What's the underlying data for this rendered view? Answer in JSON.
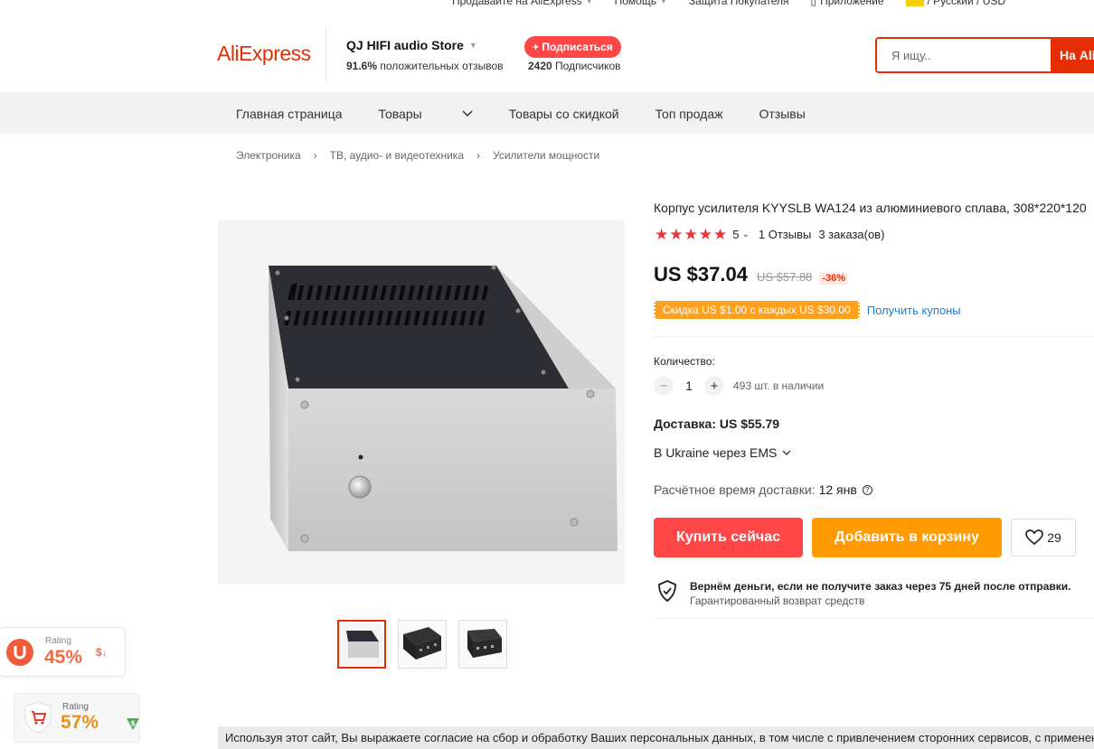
{
  "topbar": {
    "sell": "Продавайте на AliExpress",
    "help": "Помощь",
    "protection": "Защита Покупателя",
    "app": "Приложение",
    "locale": "/ Русский / USD"
  },
  "header": {
    "logo": "AliExpress",
    "store_name": "QJ HIFI audio Store",
    "positive_pct": "91.6%",
    "positive_label": "положительных отзывов",
    "subscribe_label": "+ Подписаться",
    "subscribers_count": "2420",
    "subscribers_label": "Подписчиков",
    "search_placeholder": "Я ищу..",
    "search_button": "На AliEx"
  },
  "nav": {
    "items": [
      "Главная страница",
      "Товары",
      "Товары со скидкой",
      "Топ продаж",
      "Отзывы"
    ]
  },
  "breadcrumb": [
    "Электроника",
    "ТВ, аудио- и видеотехника",
    "Усилители мощности"
  ],
  "product": {
    "title": "Корпус усилителя KYYSLB WA124 из алюминиевого сплава, 308*220*120",
    "rating": "5",
    "reviews": "1 Отзывы",
    "orders": "3 заказа(ов)",
    "price": "US $37.04",
    "old_price": "US $57.88",
    "discount": "-36%",
    "coupon": "Скидка US $1.00 с каждых US $30.00",
    "coupon_link": "Получить купоны",
    "qty_label": "Количество:",
    "qty": "1",
    "stock": "493 шт. в наличии",
    "shipping": "Доставка: US $55.79",
    "ship_to": "В Ukraine через EMS",
    "eta_label": "Расчётное время доставки:",
    "eta_value": "12 янв",
    "buy_now": "Купить сейчас",
    "add_to_cart": "Добавить в корзину",
    "wishlist_count": "29",
    "guarantee_title": "Вернём деньги, если не получите заказ через 75 дней после отправки.",
    "guarantee_sub": "Гарантированный возврат средств"
  },
  "widgets": {
    "w1_label": "Rating",
    "w1_value": "45%",
    "w1_arrow": "$↓",
    "w2_label": "Rating",
    "w2_value": "57%"
  },
  "cookie_text": "Используя этот сайт, Вы выражаете согласие на сбор и обработку Ваших персональных данных, в том числе с привлечением сторонних сервисов, с применением",
  "colors": {
    "brand": "#e62e04",
    "buy": "#ff4747",
    "cart": "#ff9a00",
    "star": "#f03232"
  }
}
